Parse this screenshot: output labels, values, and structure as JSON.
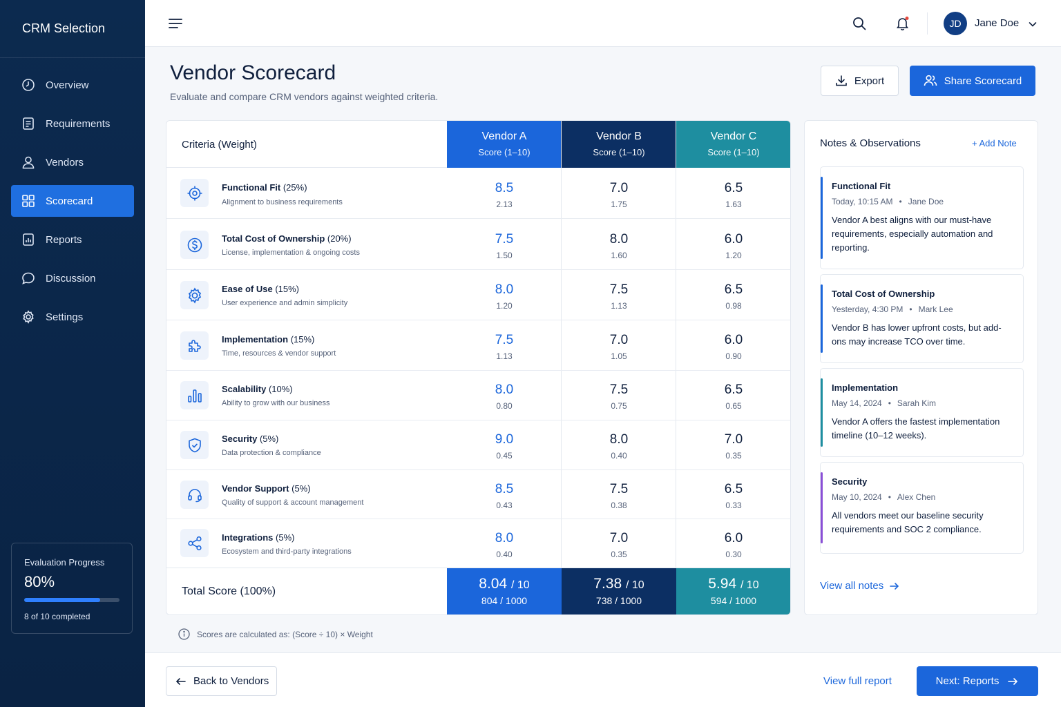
{
  "sidebar": {
    "brand": "CRM Selection",
    "items": [
      {
        "label": "Overview",
        "icon": "clock-icon"
      },
      {
        "label": "Requirements",
        "icon": "document-icon"
      },
      {
        "label": "Vendors",
        "icon": "user-icon"
      },
      {
        "label": "Scorecard",
        "icon": "grid-icon",
        "active": true
      },
      {
        "label": "Reports",
        "icon": "chart-file-icon"
      },
      {
        "label": "Discussion",
        "icon": "chat-icon"
      },
      {
        "label": "Settings",
        "icon": "gear-icon"
      }
    ],
    "progress": {
      "title": "Evaluation Progress",
      "value": "80%",
      "fraction": 0.8,
      "subtitle": "8 of 10 completed"
    }
  },
  "topbar": {
    "user_initials": "JD",
    "user_name": "Jane Doe"
  },
  "header": {
    "title": "Vendor Scorecard",
    "subtitle": "Evaluate and compare CRM vendors against weighted criteria.",
    "export_label": "Export",
    "share_label": "Share Scorecard"
  },
  "table": {
    "criteria_header": "Criteria",
    "criteria_header_suffix": "(Weight)",
    "vendors": [
      {
        "name": "Vendor A",
        "sub": "Score (1–10)"
      },
      {
        "name": "Vendor B",
        "sub": "Score (1–10)"
      },
      {
        "name": "Vendor C",
        "sub": "Score (1–10)"
      }
    ],
    "rows": [
      {
        "name": "Functional Fit",
        "weight": "(25%)",
        "desc": "Alignment to business requirements",
        "icon": "target-icon",
        "scores": [
          {
            "s": "8.5",
            "w": "2.13"
          },
          {
            "s": "7.0",
            "w": "1.75"
          },
          {
            "s": "6.5",
            "w": "1.63"
          }
        ]
      },
      {
        "name": "Total Cost of Ownership",
        "weight": "(20%)",
        "desc": "License, implementation & ongoing costs",
        "icon": "dollar-icon",
        "scores": [
          {
            "s": "7.5",
            "w": "1.50"
          },
          {
            "s": "8.0",
            "w": "1.60"
          },
          {
            "s": "6.0",
            "w": "1.20"
          }
        ]
      },
      {
        "name": "Ease of Use",
        "weight": "(15%)",
        "desc": "User experience and admin simplicity",
        "icon": "gear-icon",
        "scores": [
          {
            "s": "8.0",
            "w": "1.20"
          },
          {
            "s": "7.5",
            "w": "1.13"
          },
          {
            "s": "6.5",
            "w": "0.98"
          }
        ]
      },
      {
        "name": "Implementation",
        "weight": "(15%)",
        "desc": "Time, resources & vendor support",
        "icon": "puzzle-icon",
        "scores": [
          {
            "s": "7.5",
            "w": "1.13"
          },
          {
            "s": "7.0",
            "w": "1.05"
          },
          {
            "s": "6.0",
            "w": "0.90"
          }
        ]
      },
      {
        "name": "Scalability",
        "weight": "(10%)",
        "desc": "Ability to grow with our business",
        "icon": "bar-chart-icon",
        "scores": [
          {
            "s": "8.0",
            "w": "0.80"
          },
          {
            "s": "7.5",
            "w": "0.75"
          },
          {
            "s": "6.5",
            "w": "0.65"
          }
        ]
      },
      {
        "name": "Security",
        "weight": "(5%)",
        "desc": "Data protection & compliance",
        "icon": "shield-icon",
        "scores": [
          {
            "s": "9.0",
            "w": "0.45"
          },
          {
            "s": "8.0",
            "w": "0.40"
          },
          {
            "s": "7.0",
            "w": "0.35"
          }
        ]
      },
      {
        "name": "Vendor Support",
        "weight": "(5%)",
        "desc": "Quality of support & account management",
        "icon": "headset-icon",
        "scores": [
          {
            "s": "8.5",
            "w": "0.43"
          },
          {
            "s": "7.5",
            "w": "0.38"
          },
          {
            "s": "6.5",
            "w": "0.33"
          }
        ]
      },
      {
        "name": "Integrations",
        "weight": "(5%)",
        "desc": "Ecosystem and third-party integrations",
        "icon": "share-nodes-icon",
        "scores": [
          {
            "s": "8.0",
            "w": "0.40"
          },
          {
            "s": "7.0",
            "w": "0.35"
          },
          {
            "s": "6.0",
            "w": "0.30"
          }
        ]
      }
    ],
    "total": {
      "label": "Total Score (100%)",
      "values": [
        {
          "score": "8.04",
          "out_of": "/ 10",
          "points": "804 / 1000"
        },
        {
          "score": "7.38",
          "out_of": "/ 10",
          "points": "738 / 1000"
        },
        {
          "score": "5.94",
          "out_of": "/ 10",
          "points": "594 / 1000"
        }
      ]
    },
    "formula": "Scores are calculated as: (Score ÷ 10) × Weight"
  },
  "notes": {
    "title": "Notes & Observations",
    "add_label": "+ Add Note",
    "items": [
      {
        "title": "Functional Fit",
        "time": "Today, 10:15 AM",
        "author": "Jane Doe",
        "body": "Vendor A best aligns with our must-have requirements, especially automation and reporting.",
        "color": "#1b66db"
      },
      {
        "title": "Total Cost of Ownership",
        "time": "Yesterday, 4:30 PM",
        "author": "Mark Lee",
        "body": "Vendor B has lower upfront costs, but add-ons may increase TCO over time.",
        "color": "#1b66db"
      },
      {
        "title": "Implementation",
        "time": "May 14, 2024",
        "author": "Sarah Kim",
        "body": "Vendor A offers the fastest implementation timeline (10–12 weeks).",
        "color": "#1e8ea0"
      },
      {
        "title": "Security",
        "time": "May 10, 2024",
        "author": "Alex Chen",
        "body": "All vendors meet our baseline security requirements and SOC 2 compliance.",
        "color": "#8a4fd6"
      }
    ],
    "view_all": "View all notes"
  },
  "footer": {
    "back_label": "Back to Vendors",
    "report_link": "View full report",
    "next_label": "Next: Reports"
  }
}
